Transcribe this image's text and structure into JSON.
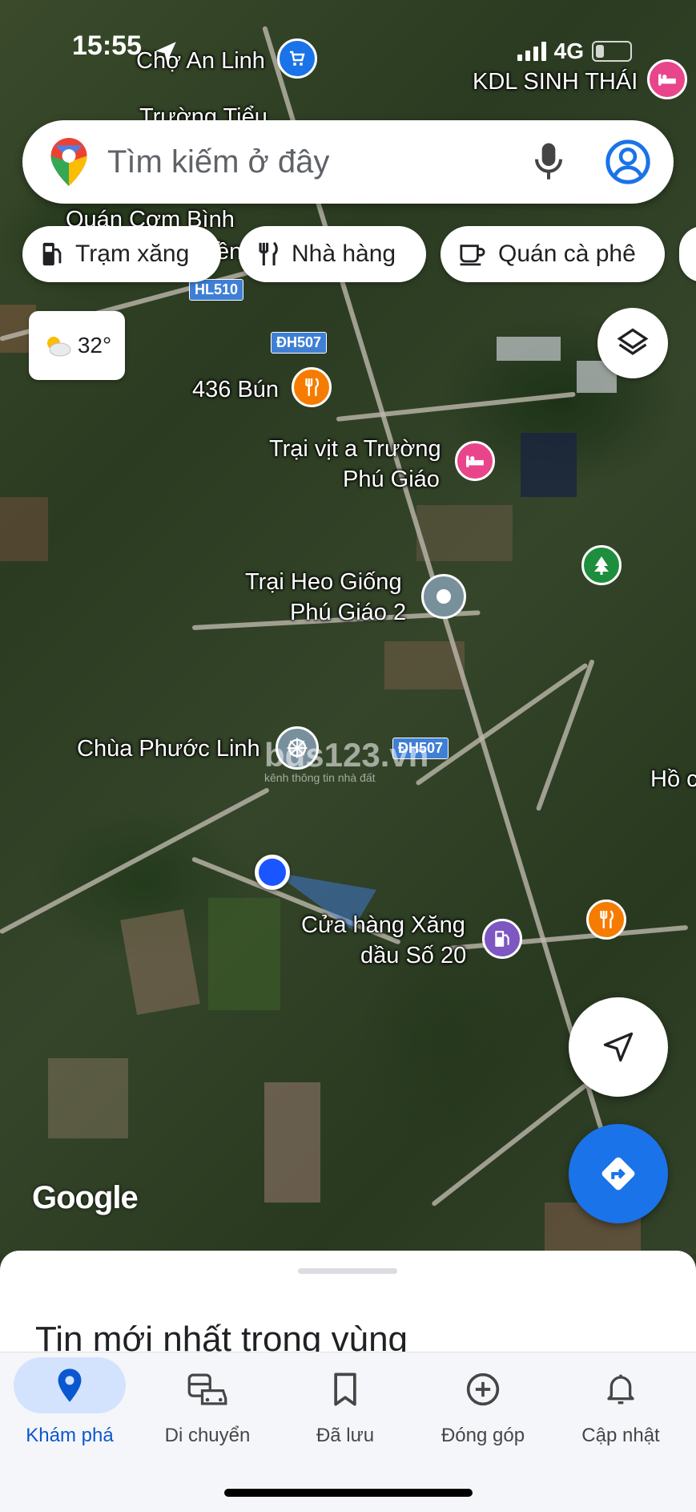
{
  "status_bar": {
    "time": "15:55",
    "network": "4G"
  },
  "search": {
    "placeholder": "Tìm kiếm ở đây"
  },
  "chips": [
    {
      "label": "Trạm xăng",
      "icon": "gas-station-icon"
    },
    {
      "label": "Nhà hàng",
      "icon": "restaurant-icon"
    },
    {
      "label": "Quán cà phê",
      "icon": "coffee-icon"
    }
  ],
  "weather": {
    "temp": "32°",
    "icon": "partly-cloudy-icon"
  },
  "map": {
    "labels": {
      "cho_an_linh": "Chợ An Linh",
      "kdl": "KDL SINH THÁI",
      "truong_tieu": "Trường Tiểu",
      "quan_com": "Quán Cơm Bình",
      "quan_com_suffix": "ền",
      "bun": "436 Bún",
      "trai_vit_1": "Trại vịt a Trường",
      "trai_vit_2": "Phú Giáo",
      "trai_heo_1": "Trại Heo Giống",
      "trai_heo_2": "Phú Giáo 2",
      "chua": "Chùa Phước Linh",
      "ho": "Hồ c",
      "xang_1": "Cửa hàng Xăng",
      "xang_2": "dầu Số 20"
    },
    "road_signs": {
      "hl510": "HL510",
      "dh507_a": "ĐH507",
      "dh507_b": "ĐH507"
    },
    "watermark": "bds123.vn",
    "watermark_sub": "kênh thông tin nhà đất",
    "attribution": "Google"
  },
  "sheet": {
    "title": "Tin mới nhất trong vùng"
  },
  "nav": [
    {
      "label": "Khám phá",
      "icon": "explore-pin-icon",
      "active": true
    },
    {
      "label": "Di chuyển",
      "icon": "commute-icon",
      "active": false
    },
    {
      "label": "Đã lưu",
      "icon": "bookmark-icon",
      "active": false
    },
    {
      "label": "Đóng góp",
      "icon": "add-circle-icon",
      "active": false
    },
    {
      "label": "Cập nhật",
      "icon": "bell-icon",
      "active": false
    }
  ],
  "colors": {
    "accent": "#1a73e8",
    "nav_active": "#0b57d0",
    "poi_restaurant": "#f57c00",
    "poi_hotel": "#e8458b",
    "poi_gas": "#7e57c2",
    "poi_park": "#1e8e3e",
    "poi_generic": "#78909c"
  }
}
